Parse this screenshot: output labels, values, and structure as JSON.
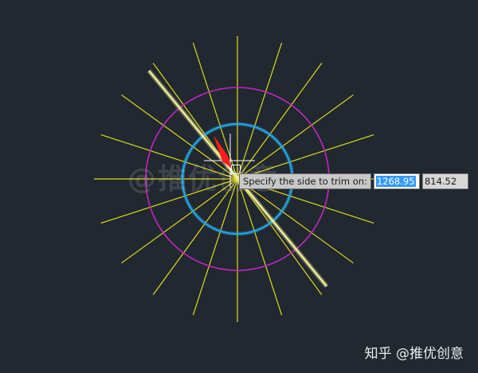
{
  "canvas": {
    "background": "#212830",
    "colors": {
      "ray_line": "#e0d71f",
      "outer_circle": "#c226c2",
      "inner_circle": "#27a8e6",
      "highlight_line": "#f2ef9a",
      "crosshair": "#ffffff",
      "arrow": "#ff1e1e"
    },
    "ray_count": 20
  },
  "tooltip": {
    "prompt": "Specify the side to trim on:",
    "x_value": "1268.95",
    "y_value": "814.52"
  },
  "watermark": {
    "center_text": "@推优创意",
    "brand_text": "知乎 @推优创意"
  },
  "icons": {
    "pickbox": "pickbox-icon",
    "arrow": "red-arrow-icon",
    "crosshair": "crosshair-cursor-icon"
  }
}
